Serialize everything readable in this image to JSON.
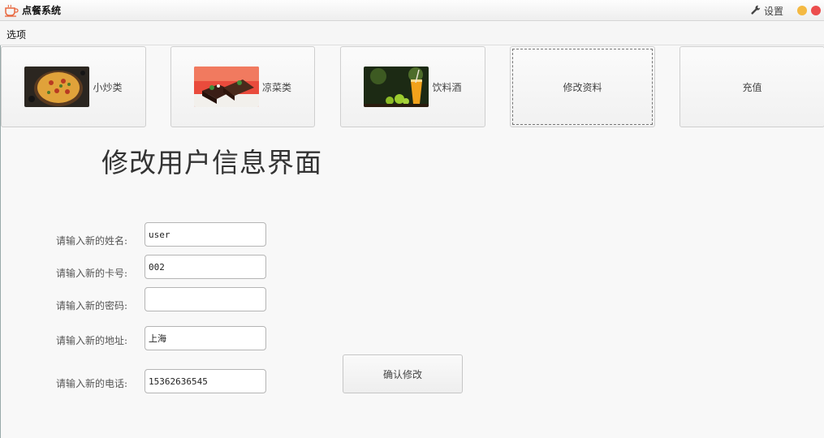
{
  "window": {
    "title": "点餐系统",
    "settings_label": "设置"
  },
  "menubar": {
    "options_label": "选项"
  },
  "nav": {
    "cards": [
      {
        "label": "小炒类",
        "image": "pizza-image"
      },
      {
        "label": "凉菜类",
        "image": "cake-image"
      },
      {
        "label": "饮料酒",
        "image": "drink-image"
      },
      {
        "label": "修改资料"
      },
      {
        "label": "充值"
      }
    ]
  },
  "page": {
    "title": "修改用户信息界面"
  },
  "form": {
    "name_label": "请输入新的姓名:",
    "name_value": "user",
    "card_label": "请输入新的卡号:",
    "card_value": "002",
    "password_label": "请输入新的密码:",
    "password_value": "",
    "address_label": "请输入新的地址:",
    "address_value": "上海",
    "phone_label": "请输入新的电话:",
    "phone_value": "15362636545",
    "confirm_label": "确认修改"
  },
  "colors": {
    "minimize": "#f4b942",
    "close": "#ec4d4d",
    "app_icon": "#e8663d"
  }
}
